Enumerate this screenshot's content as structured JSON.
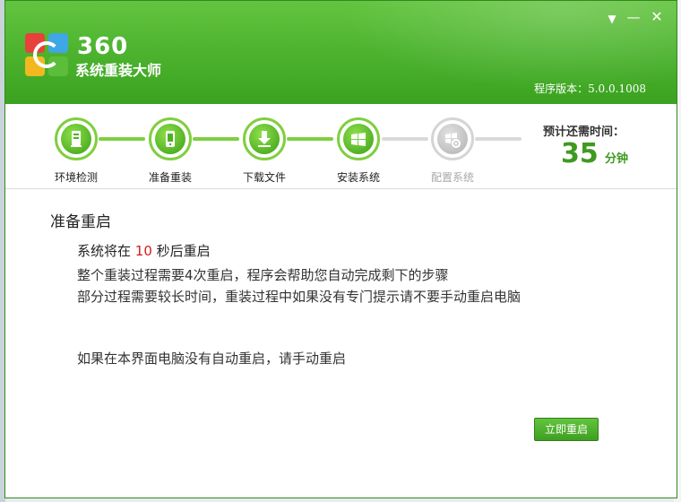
{
  "app": {
    "brand_number": "360",
    "brand_name": "系统重装大师",
    "version_label": "程序版本：5.0.0.1008"
  },
  "window_controls": {
    "menu": "▼",
    "minimize": "—",
    "close": "✕"
  },
  "steps": [
    {
      "label": "环境检测",
      "state": "done",
      "icon": "computer-icon"
    },
    {
      "label": "准备重装",
      "state": "done",
      "icon": "phone-icon"
    },
    {
      "label": "下载文件",
      "state": "done",
      "icon": "download-icon"
    },
    {
      "label": "安装系统",
      "state": "done",
      "icon": "windows-icon"
    },
    {
      "label": "配置系统",
      "state": "pending",
      "icon": "windows-gear-icon"
    }
  ],
  "remaining": {
    "title": "预计还需时间：",
    "value": "35",
    "unit": "分钟"
  },
  "content": {
    "title": "准备重启",
    "countdown_prefix": "系统将在 ",
    "countdown_value": "10",
    "countdown_suffix": " 秒后重启",
    "info_line1": "整个重装过程需要4次重启，程序会帮助您自动完成剩下的步骤",
    "info_line2": "部分过程需要较长时间，重装过程中如果没有专门提示请不要手动重启电脑",
    "manual_hint": "如果在本界面电脑没有自动重启，请手动重启"
  },
  "actions": {
    "restart_now": "立即重启"
  },
  "colors": {
    "accent_green": "#4fb531",
    "countdown_red": "#d21c1c",
    "inactive_gray": "#bdbdbd"
  }
}
